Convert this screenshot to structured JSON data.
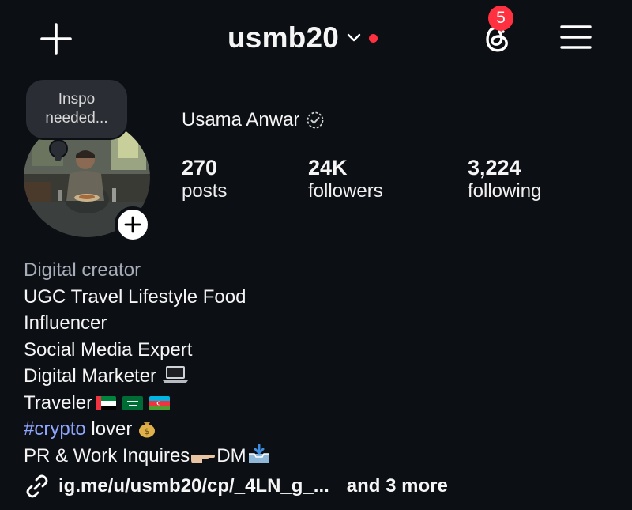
{
  "header": {
    "username": "usmb20",
    "notification_count": "5"
  },
  "profile": {
    "note_text": "Inspo needed...",
    "full_name": "Usama Anwar",
    "stats": [
      {
        "value": "270",
        "label": "posts"
      },
      {
        "value": "24K",
        "label": "followers"
      },
      {
        "value": "3,224",
        "label": "following"
      }
    ]
  },
  "bio": {
    "category": "Digital creator",
    "lines": [
      "UGC Travel Lifestyle Food",
      "Influencer",
      "Social Media Expert",
      "Digital Marketer",
      "Traveler",
      "lover",
      "PR & Work Inquires",
      "DM"
    ],
    "hashtag": "#crypto"
  },
  "link": {
    "url": "ig.me/u/usmb20/cp/_4LN_g_...",
    "more": "and 3 more"
  },
  "colors": {
    "background": "#0c0f14",
    "badge_red": "#ff3040",
    "hashtag_blue": "#8ea6ff",
    "bubble": "#2a2e34"
  },
  "icons": [
    "plus-icon",
    "chevron-down-icon",
    "threads-icon",
    "hamburger-menu-icon",
    "verified-badge-icon",
    "add-story-plus-icon",
    "link-icon",
    "laptop-emoji",
    "uae-flag",
    "saudi-flag",
    "azerbaijan-flag",
    "money-bag-emoji",
    "pointing-hand-emoji",
    "inbox-tray-emoji"
  ]
}
